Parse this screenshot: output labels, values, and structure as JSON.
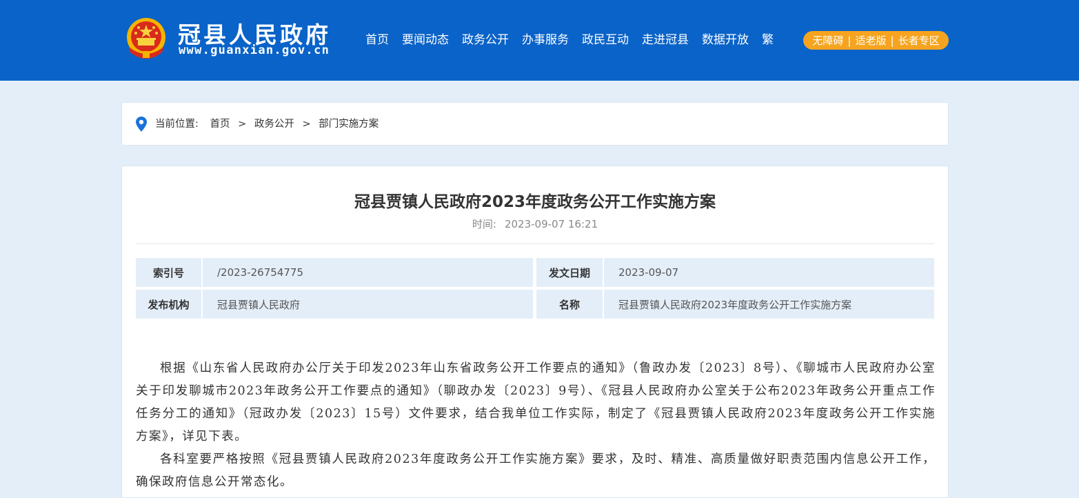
{
  "header": {
    "site_name": "冠县人民政府",
    "site_url": "www.guanxian.gov.cn",
    "nav": [
      "首页",
      "要闻动态",
      "政务公开",
      "办事服务",
      "政民互动",
      "走进冠县",
      "数据开放",
      "繁"
    ],
    "access": [
      "无障碍",
      "适老版",
      "长者专区"
    ],
    "access_sep": "|"
  },
  "breadcrumb": {
    "label": "当前位置:",
    "items": [
      "首页",
      "政务公开",
      "部门实施方案"
    ],
    "sep": ">"
  },
  "article": {
    "title": "冠县贾镇人民政府2023年度政务公开工作实施方案",
    "time_label": "时间:",
    "time_value": "2023-09-07 16:21",
    "meta": {
      "index_label": "索引号",
      "index_value": "/2023-26754775",
      "date_label": "发文日期",
      "date_value": "2023-09-07",
      "org_label": "发布机构",
      "org_value": "冠县贾镇人民政府",
      "name_label": "名称",
      "name_value": "冠县贾镇人民政府2023年度政务公开工作实施方案"
    },
    "paragraphs": [
      "根据《山东省人民政府办公厅关于印发2023年山东省政务公开工作要点的通知》（鲁政办发〔2023〕8号）、《聊城市人民政府办公室关于印发聊城市2023年政务公开工作要点的通知》（聊政办发〔2023〕9号）、《冠县人民政府办公室关于公布2023年政务公开重点工作任务分工的通知》（冠政办发〔2023〕15号）文件要求，结合我单位工作实际，制定了《冠县贾镇人民政府2023年度政务公开工作实施方案》，详见下表。",
      "各科室要严格按照《冠县贾镇人民政府2023年度政务公开工作实施方案》要求，及时、精准、高质量做好职责范围内信息公开工作，确保政府信息公开常态化。"
    ]
  },
  "colors": {
    "header_bg": "#0a63c8",
    "page_bg": "#e4eef9",
    "accent_orange": "#f6a41f",
    "location_icon": "#1a73d9"
  }
}
